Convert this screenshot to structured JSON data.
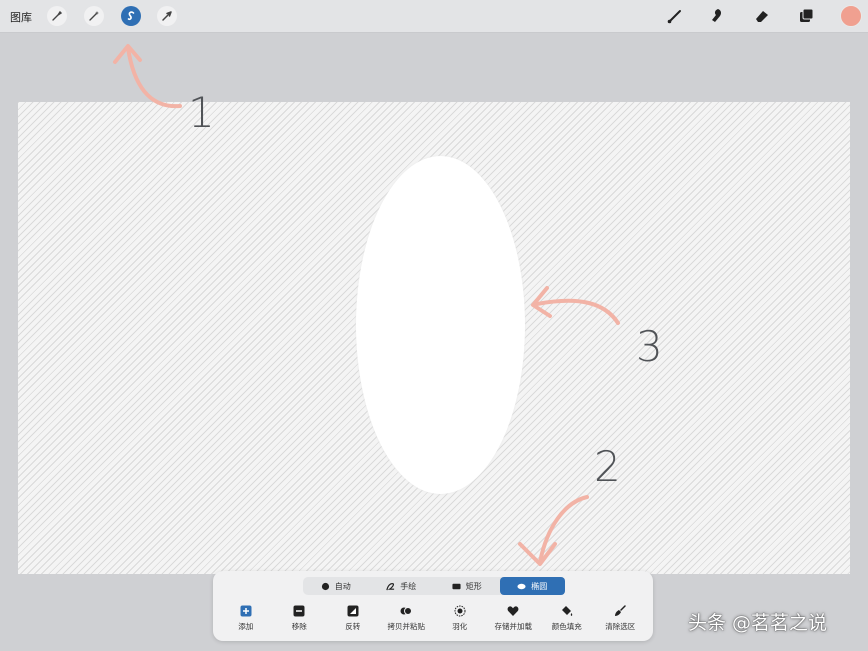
{
  "topbar": {
    "gallery_label": "图库",
    "left_tools": [
      "wrench-icon",
      "magic-wand-icon",
      "selection-icon",
      "transform-arrow-icon"
    ],
    "active_tool": "selection-icon",
    "right_tools": [
      "brush-icon",
      "smudge-icon",
      "eraser-icon",
      "layers-icon"
    ],
    "color": "#f0a090"
  },
  "annotations": {
    "one": "1",
    "two": "2",
    "three": "3",
    "arrow_color": "#f2b3a6"
  },
  "selection_panel": {
    "modes": [
      {
        "label": "自动",
        "icon": "dot-icon"
      },
      {
        "label": "手绘",
        "icon": "freehand-icon"
      },
      {
        "label": "矩形",
        "icon": "rectangle-icon"
      },
      {
        "label": "椭圆",
        "icon": "ellipse-icon",
        "active": true
      }
    ],
    "actions": [
      {
        "label": "添加",
        "icon": "add-icon"
      },
      {
        "label": "移除",
        "icon": "remove-icon"
      },
      {
        "label": "反转",
        "icon": "invert-icon"
      },
      {
        "label": "拷贝并粘贴",
        "icon": "copy-paste-icon"
      },
      {
        "label": "羽化",
        "icon": "feather-icon"
      },
      {
        "label": "存储并加载",
        "icon": "heart-icon"
      },
      {
        "label": "颜色填充",
        "icon": "fill-icon"
      },
      {
        "label": "清除选区",
        "icon": "clear-icon"
      }
    ],
    "accent": "#2f6fb4"
  },
  "watermark": "头条 @茗茗之说"
}
